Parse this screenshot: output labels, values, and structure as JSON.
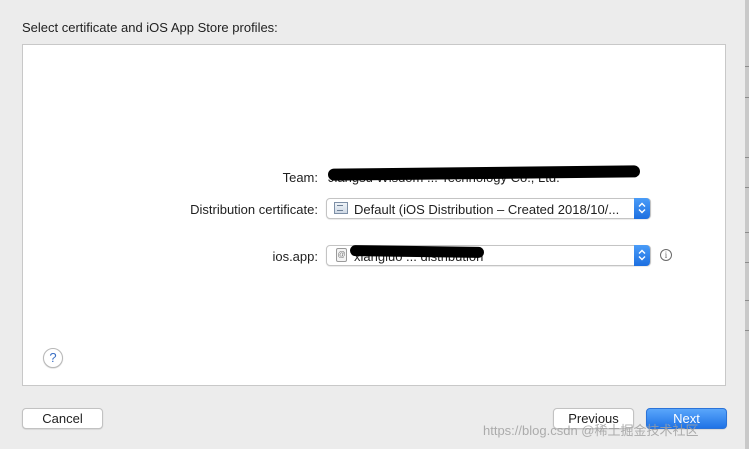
{
  "sheet": {
    "title": "Select certificate and iOS App Store profiles:"
  },
  "fields": {
    "team": {
      "label": "Team:",
      "value": "Jiangsu Wisdom ... Technology Co., Ltd."
    },
    "distribution_certificate": {
      "label": "Distribution certificate:",
      "value": "Default (iOS Distribution – Created 2018/10/..."
    },
    "app": {
      "label": "ios.app:",
      "value": "xiangluo ... distribution"
    }
  },
  "buttons": {
    "help_label": "?",
    "info_label": "i",
    "cancel_label": "Cancel",
    "previous_label": "Previous",
    "next_label": "Next"
  },
  "watermark": "https://blog.csdn @稀土掘金技术社区",
  "icons": {
    "certificate": "certificate-icon",
    "app": "app-icon",
    "stepper": "chevron-up-down-icon",
    "info": "info-icon",
    "help": "help-icon"
  },
  "colors": {
    "accent": "#1f73e6",
    "window_bg": "#ececec",
    "panel_bg": "#ffffff"
  }
}
